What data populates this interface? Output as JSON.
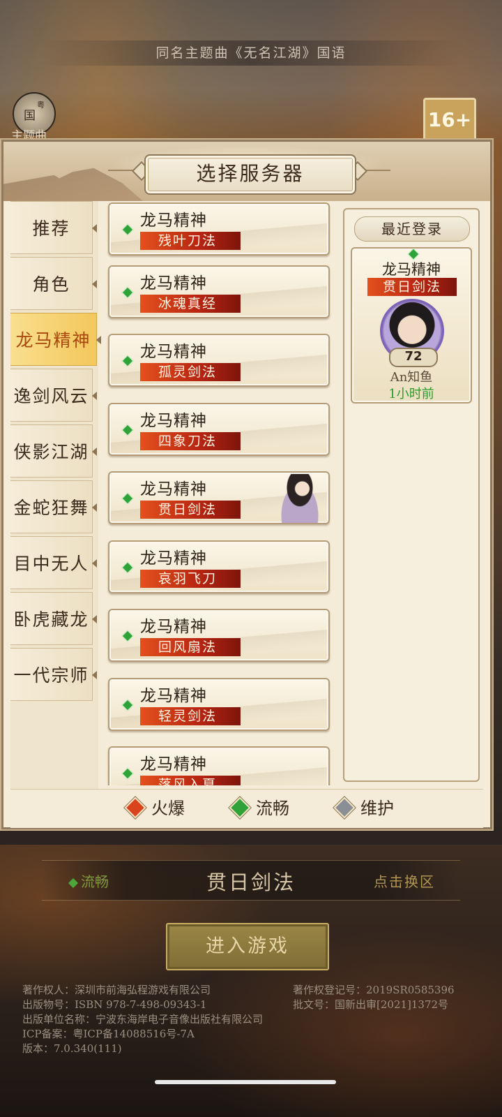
{
  "header": {
    "song_banner": "同名主题曲《无名江湖》国语",
    "theme_button_glyph_main": "国",
    "theme_button_glyph_small": "粤",
    "theme_label": "主题曲",
    "age_rating": "16+"
  },
  "panel": {
    "title": "选择服务器"
  },
  "tabs": [
    {
      "label": "推荐",
      "active": false
    },
    {
      "label": "角色",
      "active": false
    },
    {
      "label": "龙马精神",
      "active": true
    },
    {
      "label": "逸剑风云",
      "active": false
    },
    {
      "label": "侠影江湖",
      "active": false
    },
    {
      "label": "金蛇狂舞",
      "active": false
    },
    {
      "label": "目中无人",
      "active": false
    },
    {
      "label": "卧虎藏龙",
      "active": false
    },
    {
      "label": "一代宗师",
      "active": false
    }
  ],
  "servers": [
    {
      "zone": "龙马精神",
      "name": "残叶刀法",
      "status": "流畅"
    },
    {
      "zone": "龙马精神",
      "name": "冰魂真经",
      "status": "流畅"
    },
    {
      "zone": "龙马精神",
      "name": "孤灵剑法",
      "status": "流畅"
    },
    {
      "zone": "龙马精神",
      "name": "四象刀法",
      "status": "流畅"
    },
    {
      "zone": "龙马精神",
      "name": "贯日剑法",
      "status": "流畅"
    },
    {
      "zone": "龙马精神",
      "name": "哀羽飞刀",
      "status": "流畅"
    },
    {
      "zone": "龙马精神",
      "name": "回风扇法",
      "status": "流畅"
    },
    {
      "zone": "龙马精神",
      "name": "轻灵剑法",
      "status": "流畅"
    },
    {
      "zone": "龙马精神",
      "name": "落风入夏",
      "status": "流畅"
    }
  ],
  "recent": {
    "title": "最近登录",
    "zone": "龙马精神",
    "server": "贯日剑法",
    "level": "72",
    "player": "An知鱼",
    "last_login": "1小时前"
  },
  "legend": [
    {
      "label": "火爆",
      "color": "#d9441c"
    },
    {
      "label": "流畅",
      "color": "#2fa33a"
    },
    {
      "label": "维护",
      "color": "#8a8f96"
    }
  ],
  "bottom": {
    "status": "流畅",
    "selected_server": "贯日剑法",
    "switch_label": "点击换区",
    "enter_label": "进入游戏"
  },
  "copyright": {
    "owner": "著作权人：深圳市前海弘程游戏有限公司",
    "reg_no": "著作权登记号：2019SR0585396",
    "isbn": "出版物号：ISBN 978-7-498-09343-1",
    "approval": "批文号：国新出审[2021]1372号",
    "publisher": "出版单位名称：宁波东海岸电子音像出版社有限公司",
    "icp": "ICP备案：粤ICP备14088516号-7A",
    "version": "版本：7.0.340(111)"
  },
  "colors": {
    "accent_red": "#b62412",
    "accent_green": "#2fa33a",
    "active_tab": "#f3c75b"
  }
}
